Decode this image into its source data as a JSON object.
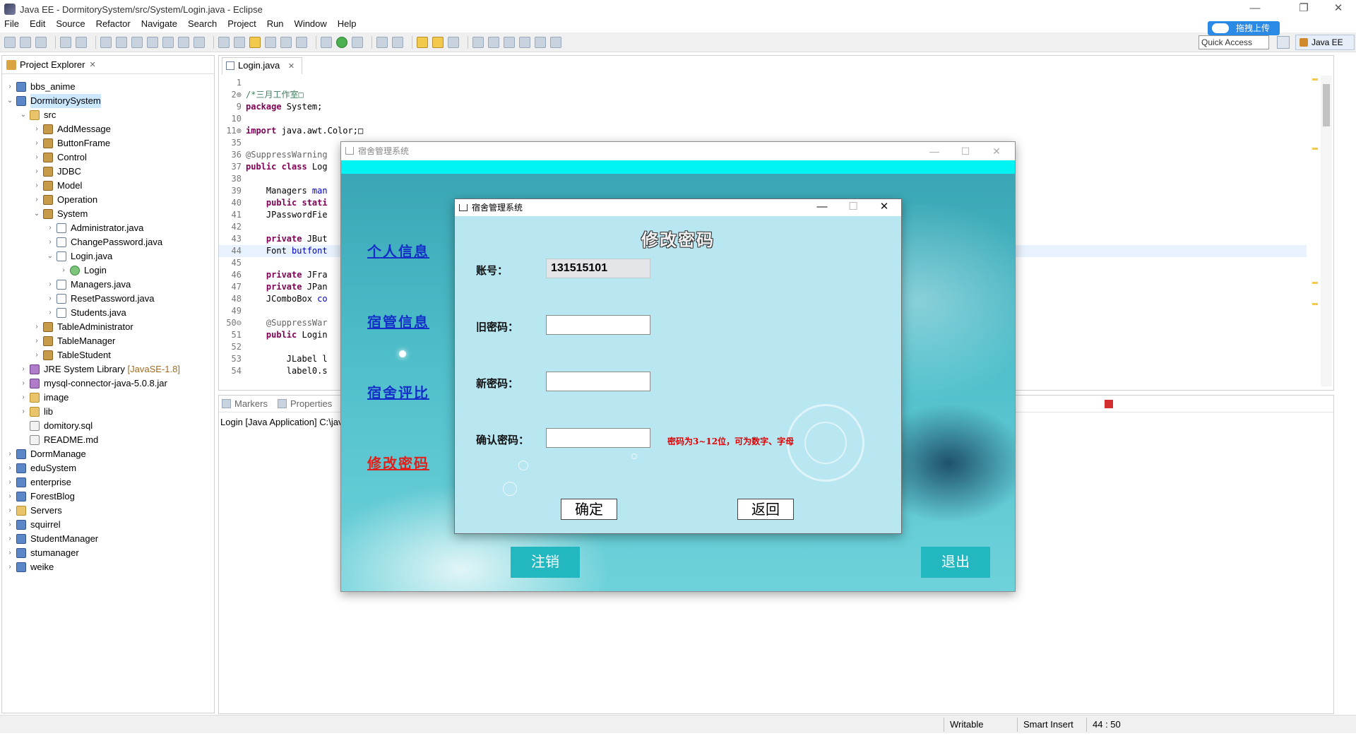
{
  "window": {
    "title": "Java EE - DormitorySystem/src/System/Login.java - Eclipse",
    "controls": [
      "—",
      "❐",
      "✕"
    ]
  },
  "menu": [
    "File",
    "Edit",
    "Source",
    "Refactor",
    "Navigate",
    "Search",
    "Project",
    "Run",
    "Window",
    "Help"
  ],
  "quick_access": "Quick Access",
  "upload_badge": "拖拽上传",
  "perspective": "Java EE",
  "explorer": {
    "tab": "Project Explorer",
    "items": [
      {
        "label": "bbs_anime",
        "extra": "",
        "level": 0,
        "chev": "›",
        "type": "project"
      },
      {
        "label": "DormitorySystem",
        "extra": "",
        "level": 0,
        "chev": "⌄",
        "type": "project",
        "selected": true
      },
      {
        "label": "src",
        "extra": "",
        "level": 1,
        "chev": "⌄",
        "type": "folder"
      },
      {
        "label": "AddMessage",
        "extra": "",
        "level": 2,
        "chev": "›",
        "type": "pkg"
      },
      {
        "label": "ButtonFrame",
        "extra": "",
        "level": 2,
        "chev": "›",
        "type": "pkg"
      },
      {
        "label": "Control",
        "extra": "",
        "level": 2,
        "chev": "›",
        "type": "pkg"
      },
      {
        "label": "JDBC",
        "extra": "",
        "level": 2,
        "chev": "›",
        "type": "pkg"
      },
      {
        "label": "Model",
        "extra": "",
        "level": 2,
        "chev": "›",
        "type": "pkg"
      },
      {
        "label": "Operation",
        "extra": "",
        "level": 2,
        "chev": "›",
        "type": "pkg"
      },
      {
        "label": "System",
        "extra": "",
        "level": 2,
        "chev": "⌄",
        "type": "pkg"
      },
      {
        "label": "Administrator.java",
        "extra": "",
        "level": 3,
        "chev": "›",
        "type": "java"
      },
      {
        "label": "ChangePassword.java",
        "extra": "",
        "level": 3,
        "chev": "›",
        "type": "java"
      },
      {
        "label": "Login.java",
        "extra": "",
        "level": 3,
        "chev": "⌄",
        "type": "java"
      },
      {
        "label": "Login",
        "extra": "",
        "level": 4,
        "chev": "›",
        "type": "cls"
      },
      {
        "label": "Managers.java",
        "extra": "",
        "level": 3,
        "chev": "›",
        "type": "java"
      },
      {
        "label": "ResetPassword.java",
        "extra": "",
        "level": 3,
        "chev": "›",
        "type": "java"
      },
      {
        "label": "Students.java",
        "extra": "",
        "level": 3,
        "chev": "›",
        "type": "java"
      },
      {
        "label": "TableAdministrator",
        "extra": "",
        "level": 2,
        "chev": "›",
        "type": "pkg"
      },
      {
        "label": "TableManager",
        "extra": "",
        "level": 2,
        "chev": "›",
        "type": "pkg"
      },
      {
        "label": "TableStudent",
        "extra": "",
        "level": 2,
        "chev": "›",
        "type": "pkg"
      },
      {
        "label": "JRE System Library",
        "extra": "[JavaSE-1.8]",
        "level": 1,
        "chev": "›",
        "type": "lib"
      },
      {
        "label": "mysql-connector-java-5.0.8.jar",
        "extra": "",
        "level": 1,
        "chev": "›",
        "type": "lib"
      },
      {
        "label": "image",
        "extra": "",
        "level": 1,
        "chev": "›",
        "type": "folder"
      },
      {
        "label": "lib",
        "extra": "",
        "level": 1,
        "chev": "›",
        "type": "folder"
      },
      {
        "label": "domitory.sql",
        "extra": "",
        "level": 1,
        "chev": "",
        "type": "file"
      },
      {
        "label": "README.md",
        "extra": "",
        "level": 1,
        "chev": "",
        "type": "file"
      },
      {
        "label": "DormManage",
        "extra": "",
        "level": 0,
        "chev": "›",
        "type": "project"
      },
      {
        "label": "eduSystem",
        "extra": "",
        "level": 0,
        "chev": "›",
        "type": "project"
      },
      {
        "label": "enterprise",
        "extra": "",
        "level": 0,
        "chev": "›",
        "type": "project"
      },
      {
        "label": "ForestBlog",
        "extra": "",
        "level": 0,
        "chev": "›",
        "type": "project"
      },
      {
        "label": "Servers",
        "extra": "",
        "level": 0,
        "chev": "›",
        "type": "folder"
      },
      {
        "label": "squirrel",
        "extra": "",
        "level": 0,
        "chev": "›",
        "type": "project"
      },
      {
        "label": "StudentManager",
        "extra": "",
        "level": 0,
        "chev": "›",
        "type": "project"
      },
      {
        "label": "stumanager",
        "extra": "",
        "level": 0,
        "chev": "›",
        "type": "project"
      },
      {
        "label": "weike",
        "extra": "",
        "level": 0,
        "chev": "›",
        "type": "project"
      }
    ]
  },
  "editor": {
    "tab": "Login.java",
    "lines": [
      {
        "n": "1",
        "html": ""
      },
      {
        "n": "2⊕",
        "html": "<span class=\"cm\">/*三月工作室□</span>"
      },
      {
        "n": "9",
        "html": "<span class=\"kw\">package</span> System;"
      },
      {
        "n": "10",
        "html": ""
      },
      {
        "n": "11⊕",
        "html": "<span class=\"kw\">import</span> java.awt.Color;□"
      },
      {
        "n": "35",
        "html": ""
      },
      {
        "n": "36",
        "html": "<span class=\"an\">@SuppressWarning</span>"
      },
      {
        "n": "37",
        "html": "<span class=\"kw\">public class</span> Log"
      },
      {
        "n": "38",
        "html": ""
      },
      {
        "n": "39",
        "html": "    Managers <span class=\"fld\">man</span>"
      },
      {
        "n": "40",
        "html": "    <span class=\"kw\">public stati</span>"
      },
      {
        "n": "41",
        "html": "    JPasswordFie"
      },
      {
        "n": "42",
        "html": ""
      },
      {
        "n": "43",
        "html": "    <span class=\"kw\">private</span> JBut"
      },
      {
        "n": "44",
        "html": "    Font <span class=\"fld\">butfont</span>",
        "current": true
      },
      {
        "n": "45",
        "html": ""
      },
      {
        "n": "46",
        "html": "    <span class=\"kw\">private</span> JFra"
      },
      {
        "n": "47",
        "html": "    <span class=\"kw\">private</span> JPan"
      },
      {
        "n": "48",
        "html": "    JComboBox <span class=\"fld\">co</span>"
      },
      {
        "n": "49",
        "html": ""
      },
      {
        "n": "50⊖",
        "html": "    <span class=\"an\">@SuppressWar</span>"
      },
      {
        "n": "51",
        "html": "    <span class=\"kw\">public</span> Login"
      },
      {
        "n": "52",
        "html": ""
      },
      {
        "n": "53",
        "html": "        JLabel l"
      },
      {
        "n": "54",
        "html": "        label0.s"
      }
    ]
  },
  "bottom_panel": {
    "tabs": [
      "Markers",
      "Properties"
    ],
    "console_label": "Login [Java Application] C:\\jav"
  },
  "status": {
    "writable": "Writable",
    "insert_mode": "Smart Insert",
    "position": "44 : 50"
  },
  "swing_main": {
    "title": "宿舍管理系统",
    "links": [
      "个人信息",
      "宿管信息",
      "宿舍评比",
      "修改密码"
    ],
    "logout_label": "注销",
    "exit_label": "退出"
  },
  "dialog": {
    "title": "宿舍管理系统",
    "heading": "修改密码",
    "account_label": "账号：",
    "account_value": "131515101",
    "old_label": "旧密码：",
    "new_label": "新密码：",
    "confirm_label": "确认密码：",
    "hint": "密码为3~12位，可为数字、字母",
    "ok_label": "确定",
    "back_label": "返回"
  }
}
